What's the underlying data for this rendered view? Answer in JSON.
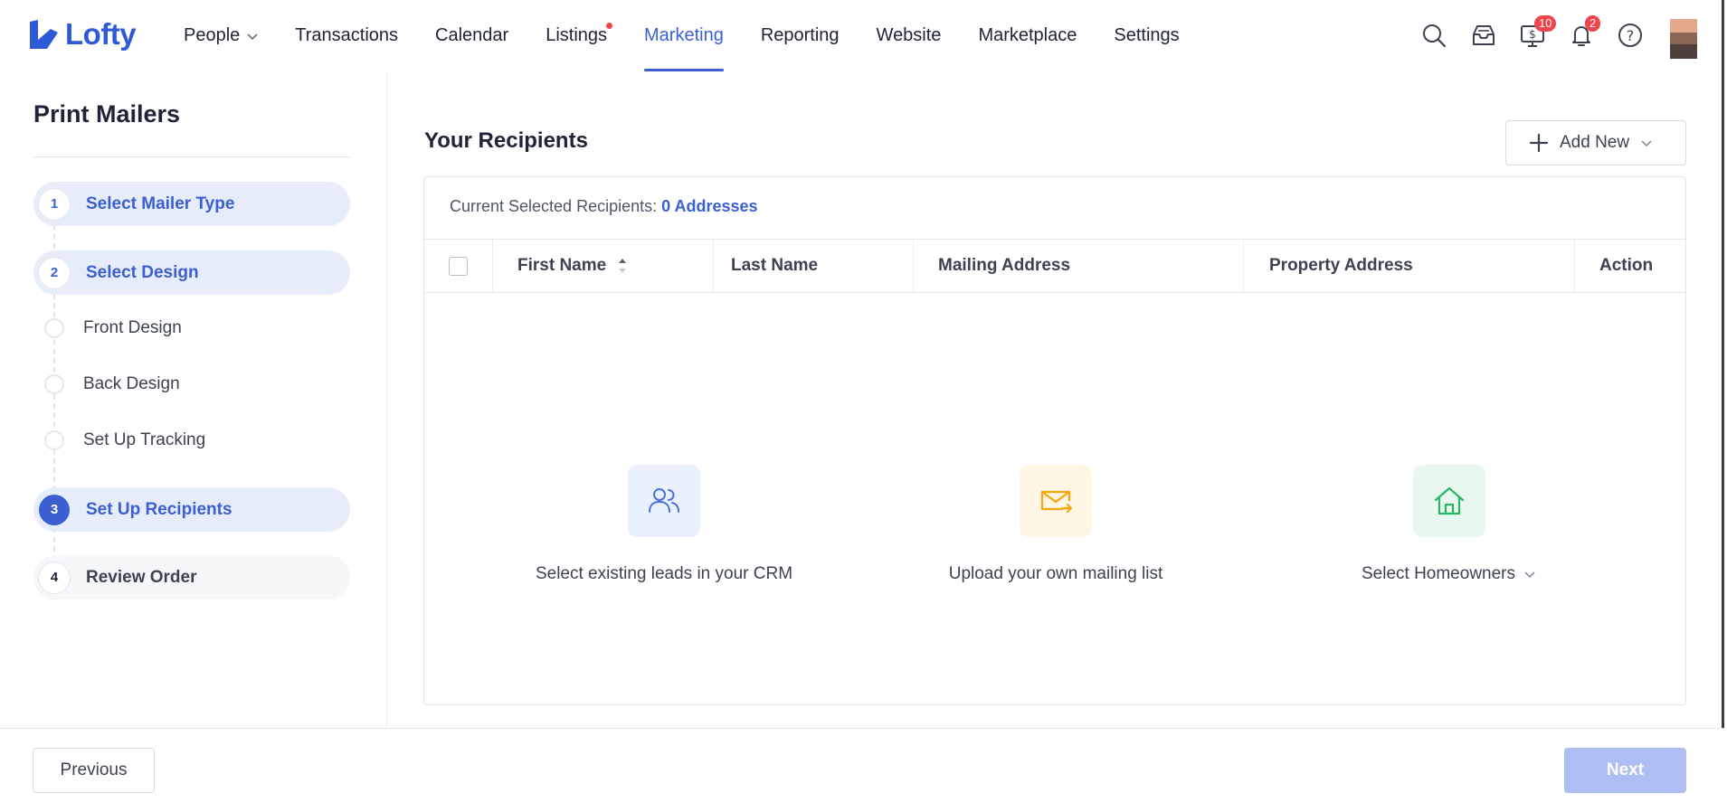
{
  "app": {
    "logo_text": "Lofty",
    "brand_color": "#2f5ad7",
    "accent_color": "#3b5fd1"
  },
  "nav": {
    "items": [
      {
        "label": "People",
        "has_chevron": true
      },
      {
        "label": "Transactions"
      },
      {
        "label": "Calendar"
      },
      {
        "label": "Listings",
        "has_dot": true
      },
      {
        "label": "Marketing",
        "active": true
      },
      {
        "label": "Reporting"
      },
      {
        "label": "Website"
      },
      {
        "label": "Marketplace"
      },
      {
        "label": "Settings"
      }
    ],
    "icons": {
      "search": "search-icon",
      "inbox": "inbox-icon",
      "billing": "dollar-monitor-icon",
      "notifications": "bell-icon",
      "help": "help-icon"
    },
    "billing_badge": "10",
    "notification_badge": "2"
  },
  "sidebar": {
    "title": "Print Mailers",
    "steps": [
      {
        "num": "1",
        "label": "Select Mailer Type"
      },
      {
        "num": "2",
        "label": "Select Design"
      },
      {
        "num": "3",
        "label": "Set Up Recipients"
      },
      {
        "num": "4",
        "label": "Review Order"
      }
    ],
    "substeps": [
      {
        "label": "Front Design"
      },
      {
        "label": "Back Design"
      },
      {
        "label": "Set Up Tracking"
      }
    ]
  },
  "main": {
    "title": "Your Recipients",
    "add_new_label": "Add New",
    "selected_prefix": "Current Selected Recipients:",
    "selected_count": "0 Addresses",
    "columns": [
      "First Name",
      "Last Name",
      "Mailing Address",
      "Property Address",
      "Action"
    ],
    "options": [
      {
        "label": "Select existing leads in your CRM",
        "icon": "users-icon",
        "tile_color": "#eaf0fd",
        "icon_color": "#4a72d9"
      },
      {
        "label": "Upload your own mailing list",
        "icon": "mail-upload-icon",
        "tile_color": "#fff6e6",
        "icon_color": "#f5a70c"
      },
      {
        "label": "Select Homeowners",
        "icon": "house-icon",
        "tile_color": "#e9f8ef",
        "icon_color": "#2bb568"
      }
    ]
  },
  "footer": {
    "previous_label": "Previous",
    "next_label": "Next"
  }
}
